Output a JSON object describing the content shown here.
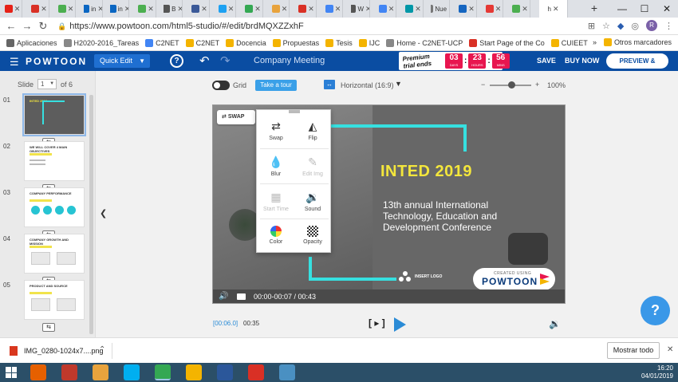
{
  "browser": {
    "tabs": [
      {
        "label": "",
        "color": "#e62117"
      },
      {
        "label": "",
        "color": "#d93025"
      },
      {
        "label": "",
        "color": "#4caf50"
      },
      {
        "label": "in",
        "color": "#0a66c2"
      },
      {
        "label": "in",
        "color": "#0a66c2"
      },
      {
        "label": "",
        "color": "#4caf50"
      },
      {
        "label": "B",
        "color": "#555555"
      },
      {
        "label": "",
        "color": "#3b5998"
      },
      {
        "label": "",
        "color": "#1da1f2"
      },
      {
        "label": "",
        "color": "#34a853"
      },
      {
        "label": "",
        "color": "#e8a33d"
      },
      {
        "label": "",
        "color": "#d93025"
      },
      {
        "label": "",
        "color": "#4285f4"
      },
      {
        "label": "W",
        "color": "#555555"
      },
      {
        "label": "",
        "color": "#4285f4"
      },
      {
        "label": "",
        "color": "#0097a7"
      },
      {
        "label": "Nue",
        "color": "#777777"
      },
      {
        "label": "",
        "color": "#1565c0"
      },
      {
        "label": "",
        "color": "#e53935"
      },
      {
        "label": "",
        "color": "#4caf50"
      }
    ],
    "active_tab": {
      "label": "h",
      "close": "✕"
    },
    "new_tab": "+",
    "window": {
      "minimize": "—",
      "maximize": "☐",
      "close": "✕"
    },
    "url": "https://www.powtoon.com/html5-studio/#/edit/brdMQXZZxhF",
    "profile_initial": "R",
    "bookmarks": [
      {
        "label": "Aplicaciones",
        "color": "#666666"
      },
      {
        "label": "H2020-2016_Tareas",
        "color": "#888888"
      },
      {
        "label": "C2NET",
        "color": "#4285f4"
      },
      {
        "label": "C2NET",
        "color": "#f4b400"
      },
      {
        "label": "Docencia",
        "color": "#f4b400"
      },
      {
        "label": "Propuestas",
        "color": "#f4b400"
      },
      {
        "label": "Tesis",
        "color": "#f4b400"
      },
      {
        "label": "IJC",
        "color": "#f4b400"
      },
      {
        "label": "Home - C2NET-UCP",
        "color": "#888888"
      },
      {
        "label": "Start Page of the Co",
        "color": "#d93025"
      },
      {
        "label": "CUIEET",
        "color": "#f4b400"
      }
    ],
    "bookmarks_more": "»",
    "other_bookmarks": "Otros marcadores"
  },
  "powtoon": {
    "logo": "POWTOON",
    "mode": "Quick Edit",
    "help": "?",
    "doc_title": "Company Meeting",
    "promo_text": "Premium trial ends",
    "timer": {
      "days": "03",
      "hours": "23",
      "mins": "56",
      "days_lbl": "DAYS",
      "hours_lbl": "HOURS",
      "mins_lbl": "MINS"
    },
    "save": "SAVE",
    "buy_now": "BUY NOW",
    "export": "PREVIEW & EXPORT"
  },
  "sidebar": {
    "slide_label": "Slide",
    "current_slide": "1",
    "of_total": "of 6",
    "slides": [
      {
        "num": "01",
        "title": "INTED 2019"
      },
      {
        "num": "02",
        "title": "WE WILL COVER 4 MAIN OBJECTIVES"
      },
      {
        "num": "03",
        "title": "COMPANY PERFORMANCE"
      },
      {
        "num": "04",
        "title": "COMPANY GROWTH AND MISSION"
      },
      {
        "num": "05",
        "title": "PRODUCT AND SOURCE"
      }
    ]
  },
  "canvas_toolbar": {
    "grid": "Grid",
    "tour": "Take a tour",
    "orientation": "Horizontal (16:9)",
    "zoom_minus": "−",
    "zoom_plus": "+",
    "zoom": "100%",
    "zoom_fraction": 0.52
  },
  "slide": {
    "swap": "SWAP",
    "title": "INTED 2019",
    "subtitle": "13th annual International Technology, Education and Development Conference",
    "insert_logo": "INSERT LOGO",
    "created_using": "CREATED USING",
    "powtoon": "POWTOON",
    "player_time": "00:00-00:07 / 00:43"
  },
  "popup": {
    "swap": "Swap",
    "flip": "Flip",
    "blur": "Blur",
    "edit_img": "Edit Img",
    "start_time": "Start Time",
    "sound": "Sound",
    "color": "Color",
    "opacity": "Opacity"
  },
  "timeline": {
    "current": "[00:06.0]",
    "total": "00:35",
    "frame": "[ ▸ ]"
  },
  "help_fab": "?",
  "downloads": {
    "file": "IMG_0280-1024x7....png",
    "show_all": "Mostrar todo"
  },
  "taskbar": {
    "time": "16:20",
    "date": "04/01/2019",
    "apps": [
      {
        "name": "firefox",
        "color": "#e66000"
      },
      {
        "name": "media",
        "color": "#c0392b"
      },
      {
        "name": "outlook",
        "color": "#e8a33d"
      },
      {
        "name": "skype",
        "color": "#00aff0"
      },
      {
        "name": "chrome",
        "color": "#34a853"
      },
      {
        "name": "explorer",
        "color": "#f4b400"
      },
      {
        "name": "word",
        "color": "#2b579a"
      },
      {
        "name": "acrobat",
        "color": "#d93025"
      },
      {
        "name": "app",
        "color": "#4a90c2"
      }
    ]
  }
}
